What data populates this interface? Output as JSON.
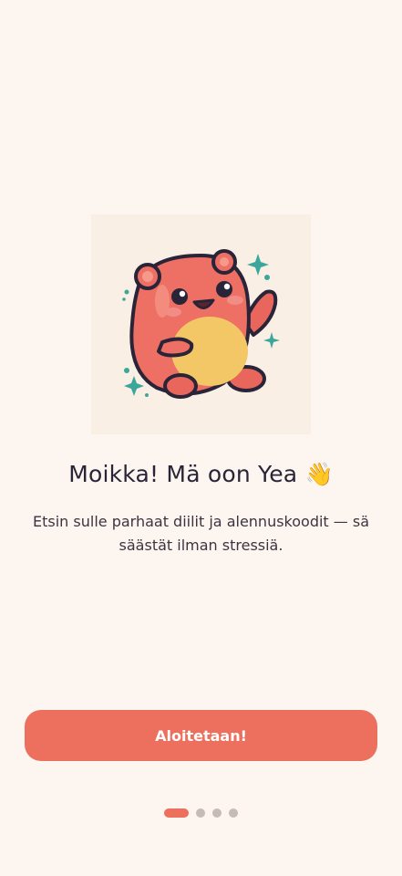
{
  "onboarding": {
    "title": "Moikka! Mä oon Yea",
    "title_emoji": "👋",
    "subtitle": "Etsin sulle parhaat diilit ja alennuskoodit — sä säästät ilman stressiä.",
    "cta_label": "Aloitetaan!",
    "mascot_icon": "waving-bear-mascot-icon",
    "current_page": 1,
    "total_pages": 4
  },
  "colors": {
    "background": "#fdf6f0",
    "accent": "#ec705d",
    "inactive_dot": "#c5bdb5"
  }
}
